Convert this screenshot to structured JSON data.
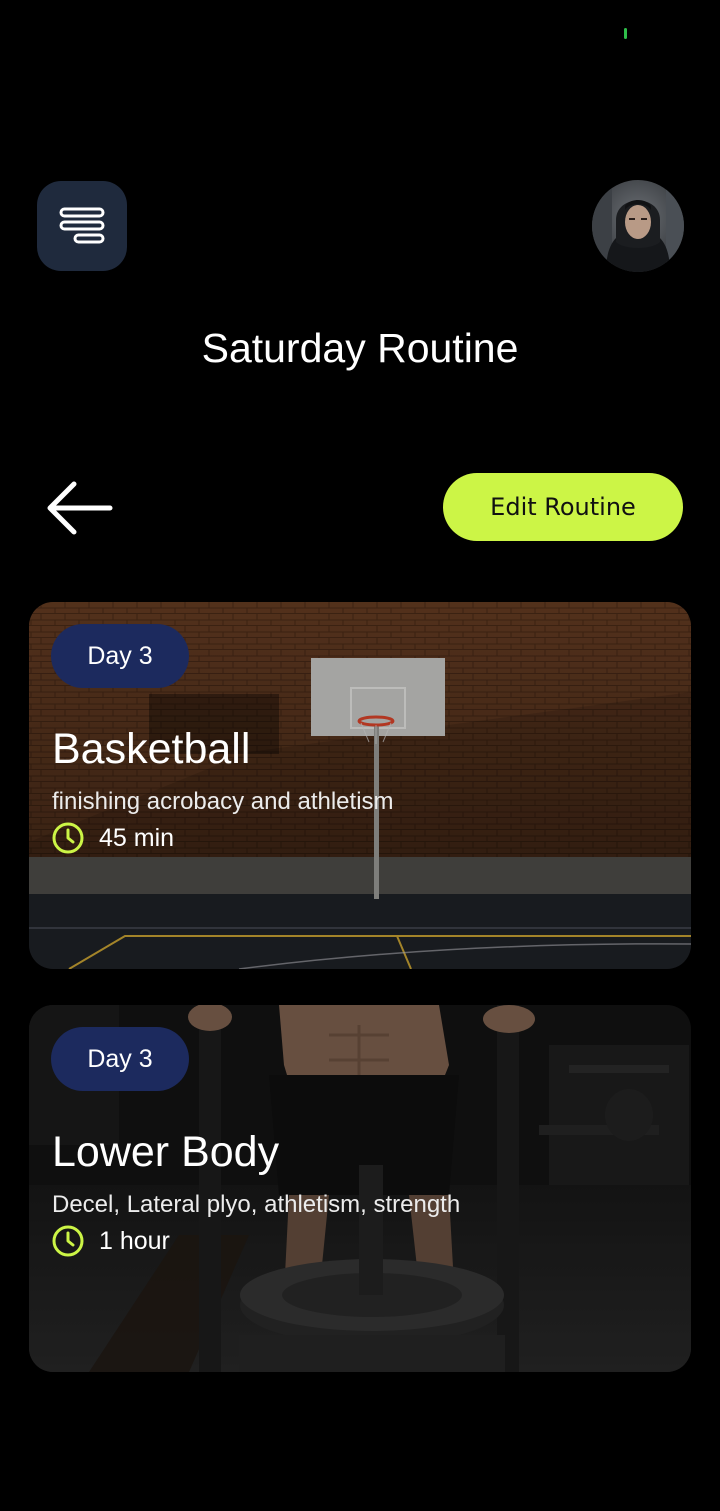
{
  "colors": {
    "background": "#000000",
    "accent": "#ccf546",
    "menu_button": "#1f2a3d",
    "badge": "#1c2a5e",
    "status_dot": "#2fbf4a"
  },
  "header": {
    "menu_icon": "menu-lines-icon",
    "avatar": "user-avatar"
  },
  "page": {
    "title": "Saturday Routine"
  },
  "toolbar": {
    "back_icon": "arrow-left-icon",
    "edit_label": "Edit Routine"
  },
  "cards": [
    {
      "badge": "Day 3",
      "title": "Basketball",
      "subtitle": "finishing acrobacy and athletism",
      "duration": "45 min",
      "duration_icon": "clock-icon"
    },
    {
      "badge": "Day 3",
      "title": "Lower Body",
      "subtitle": "Decel, Lateral plyo, athletism, strength",
      "duration": "1 hour",
      "duration_icon": "clock-icon"
    }
  ]
}
